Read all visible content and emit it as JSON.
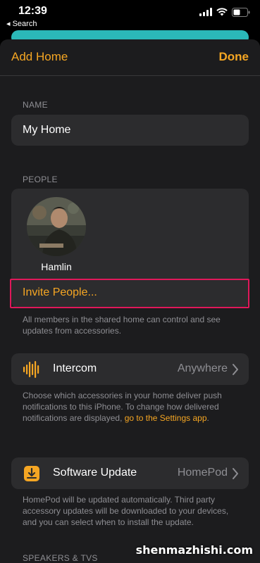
{
  "status_bar": {
    "time": "12:39",
    "back_app": "◂ Search"
  },
  "nav": {
    "left_label": "Add Home",
    "right_label": "Done"
  },
  "name_section": {
    "header": "NAME",
    "value": "My Home"
  },
  "people_section": {
    "header": "PEOPLE",
    "member_name": "Hamlin",
    "invite_label": "Invite People...",
    "footer": "All members in the shared home can control and see updates from accessories."
  },
  "intercom": {
    "title": "Intercom",
    "value": "Anywhere",
    "footer_text": "Choose which accessories in your home deliver push notifications to this iPhone. To change how delivered notifications are displayed, ",
    "footer_link": "go to the Settings app",
    "footer_end": "."
  },
  "software_update": {
    "title": "Software Update",
    "value": "HomePod",
    "footer": "HomePod will be updated automatically. Third party accessory updates will be downloaded to your devices, and you can select when to install the update."
  },
  "next_section_header": "SPEAKERS & TVS",
  "watermark": "shenmazhishi.com",
  "colors": {
    "accent": "#f5a623",
    "highlight": "#e0185a",
    "background": "#1c1c1e",
    "cell": "#2c2c2e"
  },
  "icons": {
    "intercom": "waveform-icon",
    "software_update": "download-box-icon",
    "chevron": "chevron-right-icon"
  }
}
